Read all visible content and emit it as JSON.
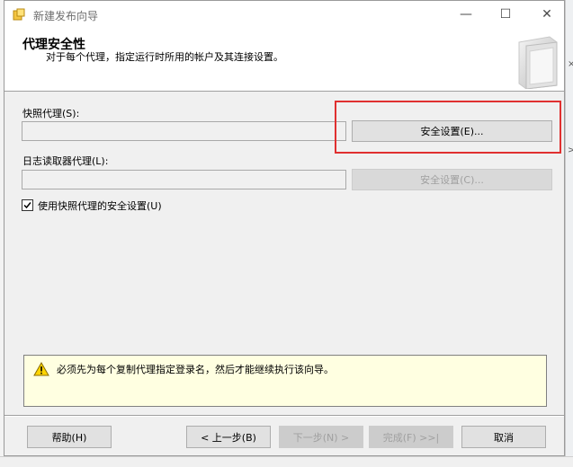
{
  "window": {
    "title": "新建发布向导",
    "controls": {
      "minimize": "—",
      "maximize": "☐",
      "close": "✕"
    }
  },
  "header": {
    "title": "代理安全性",
    "subtitle": "对于每个代理，指定运行时所用的帐户及其连接设置。"
  },
  "snapshot_agent": {
    "label": "快照代理(S):",
    "value": "",
    "button": "安全设置(E)..."
  },
  "log_reader_agent": {
    "label": "日志读取器代理(L):",
    "value": "",
    "button": "安全设置(C)..."
  },
  "use_snapshot_security": {
    "label": "使用快照代理的安全设置(U)",
    "checked": true
  },
  "warning": {
    "icon": "warning-icon",
    "text": "必须先为每个复制代理指定登录名，然后才能继续执行该向导。"
  },
  "footer": {
    "help": "帮助(H)",
    "back": "< 上一步(B)",
    "next": "下一步(N) >",
    "finish": "完成(F) >>|",
    "cancel": "取消"
  },
  "background": {
    "right_glyphs": [
      "×",
      ">"
    ]
  },
  "colors": {
    "highlight": "#e03030",
    "warning_bg": "#ffffe1",
    "dialog_bg": "#f0f0f0"
  }
}
